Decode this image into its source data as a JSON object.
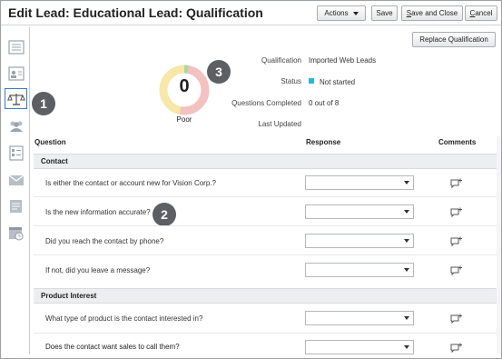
{
  "header": {
    "title": "Edit Lead: Educational Lead: Qualification",
    "actions_label": "Actions",
    "save_label": "Save",
    "save_close_prefix": "S",
    "save_close_rest": "ave and Close",
    "cancel_prefix": "C",
    "cancel_rest": "ancel"
  },
  "nav": {
    "items": [
      "summary-icon",
      "contact-card-icon",
      "scales-icon",
      "team-icon",
      "checklist-icon",
      "email-icon",
      "notes-icon",
      "calendar-icon"
    ],
    "active_index": 2
  },
  "callouts": [
    "1",
    "2",
    "3"
  ],
  "summary": {
    "replace_label": "Replace Qualification",
    "score": "0",
    "grade": "Poor",
    "donut_colors": [
      "#a8d8a0",
      "#f7e7a8",
      "#f4c1c1"
    ],
    "fields": [
      {
        "label": "Qualification",
        "value": "Imported Web Leads"
      },
      {
        "label": "Status",
        "value": "Not started"
      },
      {
        "label": "Questions Completed",
        "value": "0 out of 8"
      },
      {
        "label": "Last Updated",
        "value": ""
      }
    ],
    "status_color": "#29b6d8"
  },
  "table": {
    "headers": {
      "question": "Question",
      "response": "Response",
      "comments": "Comments"
    },
    "sections": [
      {
        "label": "Contact",
        "questions": [
          "Is either the contact or account new for Vision Corp.?",
          "Is the new information accurate?",
          "Did you reach the contact by phone?",
          "If not, did you leave a message?"
        ]
      },
      {
        "label": "Product Interest",
        "questions": [
          "What type of product is the contact interested in?",
          "Does the contact want sales to call them?"
        ]
      }
    ]
  }
}
